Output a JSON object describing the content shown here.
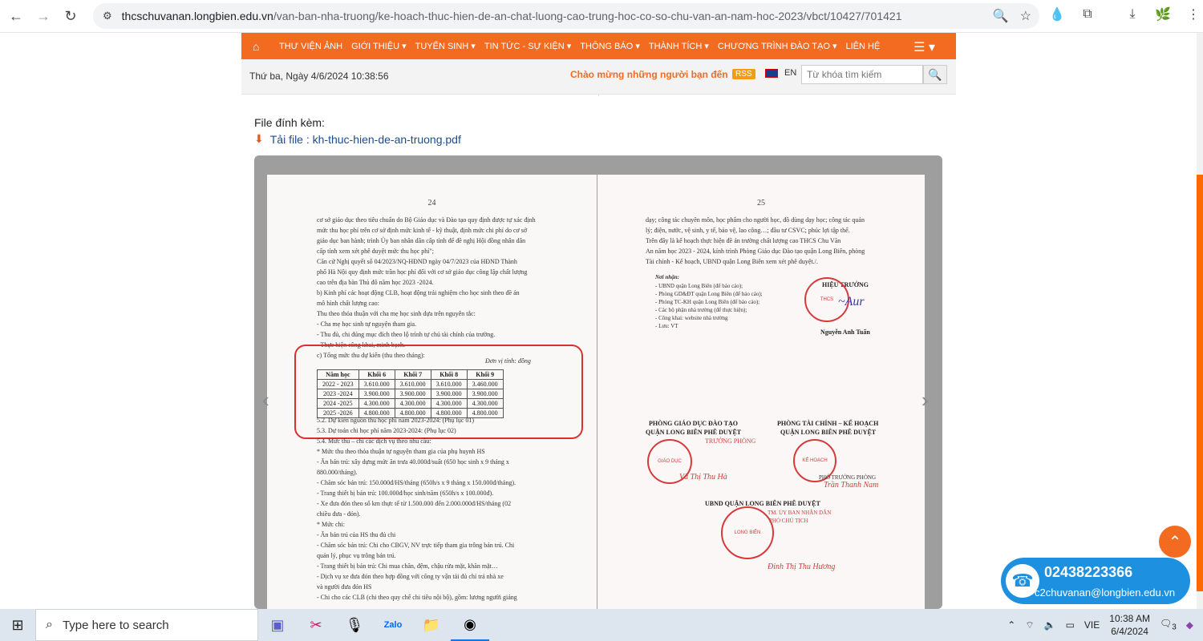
{
  "browser": {
    "url_host": "thcschuvanan.longbien.edu.vn",
    "url_path": "/van-ban-nha-truong/ke-hoach-thuc-hien-de-an-chat-luong-cao-trung-hoc-co-so-chu-van-an-nam-hoc-2023/vbct/10427/701421"
  },
  "menu": {
    "items": [
      "THƯ VIỆN ẢNH",
      "GIỚI THIỆU ▾",
      "TUYỂN SINH ▾",
      "TIN TỨC - SỰ KIỆN ▾",
      "THÔNG BÁO ▾",
      "THÀNH TÍCH ▾",
      "CHƯƠNG TRÌNH ĐÀO TẠO ▾",
      "LIÊN HỆ"
    ]
  },
  "infobar": {
    "date": "Thứ ba, Ngày 4/6/2024 10:38:56",
    "welcome": "Chào mừng những người bạn đến vớ",
    "rss": "RSS",
    "lang": "EN",
    "search_placeholder": "Từ khóa tìm kiếm"
  },
  "attachment": {
    "label": "File đính kèm:",
    "link_text": "Tải file : kh-thuc-hien-de-an-truong.pdf"
  },
  "pdf": {
    "left_page_num": "24",
    "right_page_num": "25",
    "left_text_top": [
      "cơ sở giáo dục theo tiêu chuẩn do Bộ Giáo dục và Đào tạo quy định được tự xác định",
      "mức thu học phí trên cơ sở định mức kinh tế - kỹ thuật, định mức chi phí do cơ sở",
      "giáo dục ban hành; trình Ủy ban nhân dân cấp tỉnh để đề nghị Hội đồng nhân dân",
      "cấp tỉnh xem xét phê duyệt mức thu học phí\";",
      "Căn cứ Nghị quyết số 04/2023/NQ-HĐND ngày 04/7/2023 của HĐND Thành",
      "phố Hà Nội quy định mức trần học phí đối với cơ sở giáo dục công lập chất lượng",
      "cao trên địa bàn Thủ đô năm học 2023 -2024.",
      "b) Kinh phí các hoạt động CLB, hoạt động trải nghiệm cho học sinh theo đề án",
      "mô hình chất lượng cao:",
      "Thu theo thỏa thuận với cha mẹ học sinh dựa trên nguyên tắc:",
      "- Cha mẹ học sinh tự nguyện tham gia.",
      "- Thu đủ, chi đúng mục đích theo lộ trình tự chủ tài chính của trường.",
      "- Thực hiện công khai, minh bạch.",
      "c) Tổng mức thu dự kiến (thu theo tháng):"
    ],
    "unit_note": "Đơn vị tính: đồng",
    "table_headers": [
      "Năm học",
      "Khối 6",
      "Khối 7",
      "Khối 8",
      "Khối 9"
    ],
    "table_rows": [
      [
        "2022 - 2023",
        "3.610.000",
        "3.610.000",
        "3.610.000",
        "3.460.000"
      ],
      [
        "2023 -2024",
        "3.900.000",
        "3.900.000",
        "3.900.000",
        "3.900.000"
      ],
      [
        "2024 -2025",
        "4.300.000",
        "4.300.000",
        "4.300.000",
        "4.300.000"
      ],
      [
        "2025 -2026",
        "4.800.000",
        "4.800.000",
        "4.800.000",
        "4.800.000"
      ]
    ],
    "left_text_bottom": [
      "5.2. Dự kiến nguồn thu học phí năm 2023-2024: (Phụ lục 01)",
      "5.3. Dự toán chi học phí năm 2023-2024: (Phụ lục 02)",
      "5.4. Mức thu – chi các dịch vụ theo nhu cầu:",
      "* Mức thu theo thỏa thuận tự nguyện tham gia của phụ huynh HS",
      "- Ăn bán trú: xây dựng mức ăn trưa 40.000đ/suất (650 học sinh x 9 tháng x",
      "880.000/tháng).",
      "- Chăm sóc bán trú: 150.000đ/HS/tháng (650h/s x 9 tháng x 150.000đ/tháng).",
      "- Trang thiết bị bán trú: 100.000đ/học sinh/năm (650h/s x 100.000đ).",
      "- Xe đưa đón theo số km thực tế từ 1.500.000 đến 2.000.000đ/HS/tháng (02",
      "chiều đưa - đón).",
      "* Mức chi:",
      "- Ăn bán trú của HS thu đủ chi",
      "- Chăm sóc bán trú: Chi cho CBGV, NV trực tiếp tham gia trông bán trú. Chi",
      "quản lý, phục vụ trông bán trú.",
      "- Trang thiết bị bán trú: Chi mua chăn, đệm, chậu rửa mặt, khăn mặt…",
      "- Dịch vụ xe đưa đón theo hợp đồng với công ty vận tải đủ chỉ trả nhà xe",
      "và người đưa đón HS",
      "- Chi cho các CLB (chi theo quy chế chi tiêu nội bộ), gồm: lương người giảng"
    ],
    "right_text": [
      "dạy; công tác chuyên môn, học phẩm cho người học, đồ dùng dạy học; công tác quản",
      "lý; điện, nước, vệ sinh, y tế, bảo vệ, lao công…; đầu tư CSVC; phúc lợi tập thể.",
      "Trên đây là kế hoạch thực hiện đề án trường chất lượng cao  THCS Chu Văn",
      "An năm học 2023 - 2024, kính trình Phòng Giáo dục Đào tạo quận Long Biên, phòng",
      "Tài chính - Kế hoạch, UBND quận Long Biên xem xét phê duyệt./."
    ],
    "recipients_title": "Nơi nhận:",
    "recipients": [
      "- UBND quận Long Biên (để báo cáo);",
      "- Phòng GD&ĐT quận Long Biên (để báo cáo);",
      "- Phòng TC-KH quận Long Biên (để báo cáo);",
      "- Các bộ phận nhà trường (để thực hiện);",
      "- Công khai: website nhà trường",
      "- Lưu: VT"
    ],
    "principal_title": "HIỆU TRƯỞNG",
    "principal_name": "Nguyễn Anh Tuấn",
    "gd_title_1": "PHÒNG GIÁO DỤC ĐÀO TẠO",
    "gd_title_2": "QUẬN LONG BIÊN PHÊ DUYỆT",
    "gd_role": "TRƯỞNG PHÒNG",
    "gd_name": "Vũ Thị Thu Hà",
    "tc_title_1": "PHÒNG TÀI CHÍNH – KẾ HOẠCH",
    "tc_title_2": "QUẬN LONG BIÊN PHÊ DUYỆT",
    "tc_role": "PHÓ TRƯỞNG PHÒNG",
    "tc_name": "Trần Thanh Nam",
    "ubnd_title": "UBND QUẬN LONG BIÊN PHÊ DUYỆT",
    "ubnd_role_1": "TM. ỦY BAN NHÂN DÂN",
    "ubnd_role_2": "PHÓ CHỦ TỊCH",
    "ubnd_name": "Đinh Thị Thu Hương"
  },
  "contact": {
    "phone": "02438223366",
    "email": "c2chuvanan@longbien.edu.vn"
  },
  "taskbar": {
    "search_placeholder": "Type here to search",
    "lang": "VIE",
    "time": "10:38 AM",
    "date": "6/4/2024",
    "notif_count": "3"
  }
}
